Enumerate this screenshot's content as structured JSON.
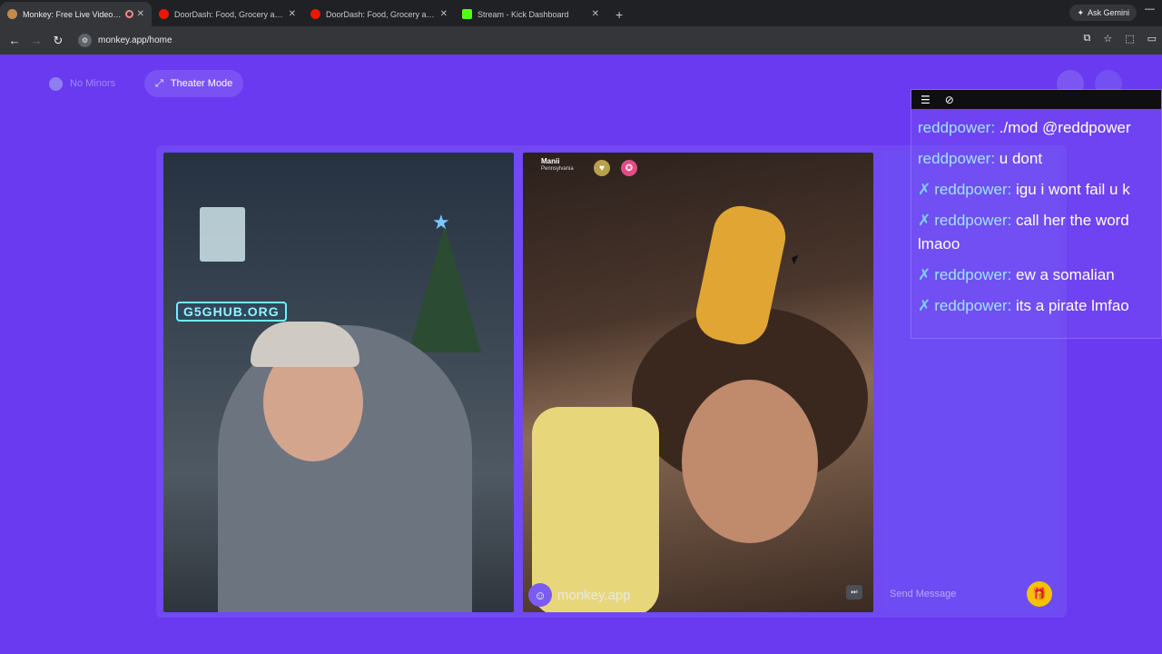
{
  "browser": {
    "tabs": [
      {
        "title": "Monkey: Free Live Video Ch",
        "favicon_color": "#c58a4a",
        "active": true,
        "recording": true
      },
      {
        "title": "DoorDash: Food, Grocery and R",
        "favicon_color": "#eb1700",
        "active": false
      },
      {
        "title": "DoorDash: Food, Grocery and R",
        "favicon_color": "#eb1700",
        "active": false
      },
      {
        "title": "Stream - Kick Dashboard",
        "favicon_color": "#53fc18",
        "active": false
      }
    ],
    "new_tab_glyph": "+",
    "gemini_label": "Ask Gemini",
    "url": "monkey.app/home"
  },
  "page": {
    "accent": "#6a3af0",
    "no_minors_label": "No Minors",
    "theater_label": "Theater Mode",
    "remote_user": {
      "name": "Manii",
      "location": "Pennsylvania"
    },
    "watermark": "monkey.app",
    "send_placeholder": "Send Message",
    "sticker_text": "G5GHUB.ORG"
  },
  "chat_overlay": {
    "messages": [
      {
        "user": "reddpower",
        "text": "./mod @reddpower",
        "sword": false
      },
      {
        "user": "reddpower",
        "text": "u dont",
        "sword": false
      },
      {
        "user": "reddpower",
        "text": "igu i wont fail u k",
        "sword": true
      },
      {
        "user": "reddpower",
        "text": "call her the word lmaoo",
        "sword": true
      },
      {
        "user": "reddpower",
        "text": "ew a somalian",
        "sword": true
      },
      {
        "user": "reddpower",
        "text": "its a pirate lmfao",
        "sword": true
      }
    ]
  }
}
